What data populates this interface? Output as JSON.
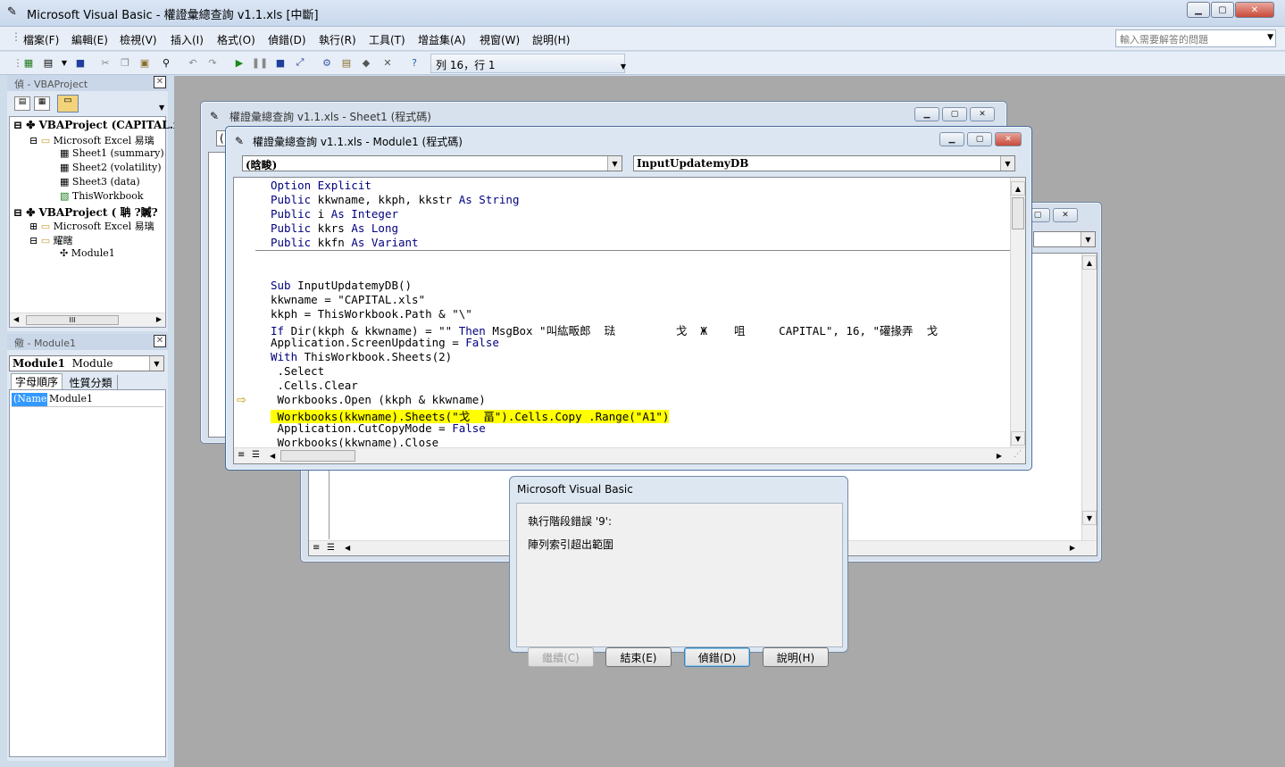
{
  "app": {
    "title": "Microsoft Visual Basic - 權證彙總查詢 v1.1.xls [中斷]",
    "minimize": "0",
    "maximize": "1",
    "close": "r"
  },
  "menu": [
    "檔案(F)",
    "編輯(E)",
    "檢視(V)",
    "插入(I)",
    "格式(O)",
    "偵錯(D)",
    "執行(R)",
    "工具(T)",
    "增益集(A)",
    "視窗(W)",
    "說明(H)"
  ],
  "help_box": {
    "placeholder": "輸入需要解答的問題"
  },
  "toolbar": {
    "position": "列 16，行 1"
  },
  "project_pane": {
    "title": "偵 - VBAProject",
    "tree": [
      "VBAProject (CAPITAL.xls)",
      "Microsoft Excel 易璃",
      "Sheet1 (summary)",
      "Sheet2 (volatility)",
      "Sheet3 (data)",
      "ThisWorkbook",
      "VBAProject (   聃    ?贓?",
      "Microsoft Excel 易璃",
      "耀瞎",
      "Module1"
    ],
    "scroll_marker": "III"
  },
  "props_pane": {
    "title": "儆 - Module1",
    "object_name": "Module1",
    "object_type": "Module",
    "tab_alpha": "字母順序",
    "tab_category": "性質分類",
    "prop_name": "(Name)",
    "prop_value": "Module1"
  },
  "sheet1_window": {
    "title": "權證彙總查詢 v1.1.xls - Sheet1 (程式碼)",
    "combo_stub": "("
  },
  "module1_window": {
    "title": "權證彙總查詢 v1.1.xls - Module1 (程式碼)",
    "object_combo": "(晗畯)",
    "proc_combo": "InputUpdatemyDB",
    "code": [
      [
        {
          "t": "Option Explicit",
          "c": "kw"
        }
      ],
      [
        {
          "t": "Public",
          "c": "kw"
        },
        {
          "t": " kkwname, kkph, kkstr ",
          "c": "txt"
        },
        {
          "t": "As String",
          "c": "kw"
        }
      ],
      [
        {
          "t": "Public",
          "c": "kw"
        },
        {
          "t": " i ",
          "c": "txt"
        },
        {
          "t": "As Integer",
          "c": "kw"
        }
      ],
      [
        {
          "t": "Public",
          "c": "kw"
        },
        {
          "t": " kkrs ",
          "c": "txt"
        },
        {
          "t": "As Long",
          "c": "kw"
        }
      ],
      [
        {
          "t": "Public",
          "c": "kw"
        },
        {
          "t": " kkfn ",
          "c": "txt"
        },
        {
          "t": "As Variant",
          "c": "kw"
        }
      ],
      [],
      [
        {
          "t": "Sub",
          "c": "kw"
        },
        {
          "t": " InputUpdatemyDB()",
          "c": "txt"
        }
      ],
      [
        {
          "t": "kkwname = \"CAPITAL.xls\"",
          "c": "txt"
        }
      ],
      [
        {
          "t": "kkph = ThisWorkbook.Path & \"\\\"",
          "c": "txt"
        }
      ],
      [
        {
          "t": "If",
          "c": "kw"
        },
        {
          "t": " Dir(kkph & kkwname) = \"\" ",
          "c": "txt"
        },
        {
          "t": "Then",
          "c": "kw"
        },
        {
          "t": " MsgBox \"叫紘畈郎  琺         戈  Ж    咀     CAPITAL\", 16, \"礶掾弄  戈",
          "c": "txt"
        }
      ],
      [
        {
          "t": "Application.ScreenUpdating = ",
          "c": "txt"
        },
        {
          "t": "False",
          "c": "kw"
        }
      ],
      [
        {
          "t": "With",
          "c": "kw"
        },
        {
          "t": " ThisWorkbook.Sheets(2)",
          "c": "txt"
        }
      ],
      [
        {
          "t": " .Select",
          "c": "txt"
        }
      ],
      [
        {
          "t": " .Cells.Clear",
          "c": "txt"
        }
      ],
      [
        {
          "t": " Workbooks.Open (kkph & kkwname)",
          "c": "txt"
        }
      ],
      [
        {
          "t": " Workbooks(kkwname).Sheets(\"戈  畐\").Cells.Copy .Range(\"A1\")",
          "c": "hl"
        }
      ],
      [
        {
          "t": " Application.CutCopyMode = ",
          "c": "txt"
        },
        {
          "t": "False",
          "c": "kw"
        }
      ],
      [
        {
          "t": " Workbooks(kkwname).Close",
          "c": "txt"
        }
      ]
    ]
  },
  "dialog": {
    "title": "Microsoft Visual Basic",
    "message1": "執行階段錯誤 '9':",
    "message2": "陣列索引超出範圍",
    "btn_continue": "繼續(C)",
    "btn_end": "結束(E)",
    "btn_debug": "偵錯(D)",
    "btn_help": "說明(H)"
  },
  "colors": {
    "keyword": "#00007f",
    "highlight": "#ffff00",
    "mdi_background": "#a9a9a9"
  }
}
